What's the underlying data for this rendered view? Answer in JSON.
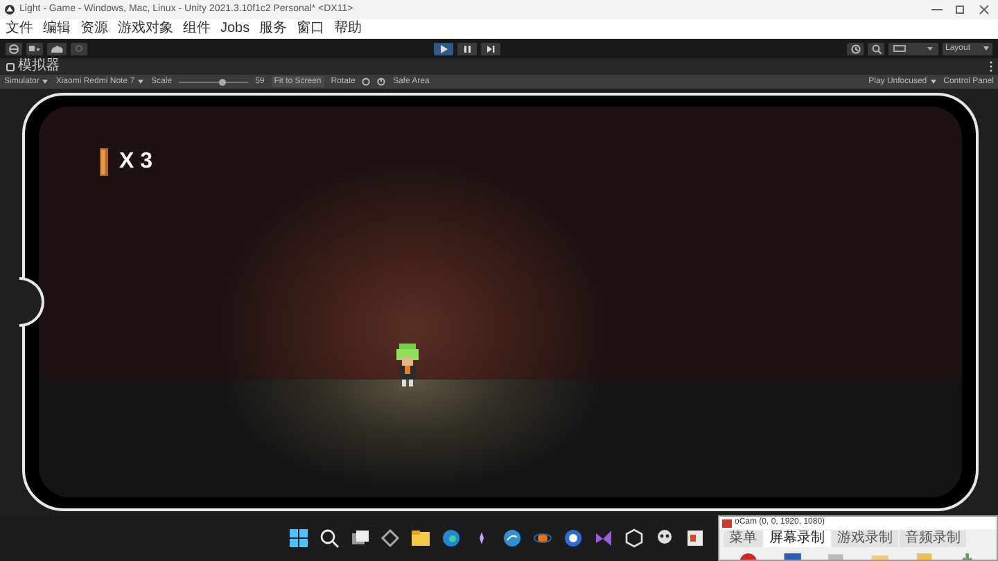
{
  "window": {
    "title": "Light - Game - Windows, Mac, Linux - Unity 2021.3.10f1c2 Personal* <DX11>"
  },
  "menu": [
    "文件",
    "编辑",
    "资源",
    "游戏对象",
    "组件",
    "Jobs",
    "服务",
    "窗口",
    "帮助"
  ],
  "play_controls": [
    {
      "kind": "play",
      "selected": true
    },
    {
      "kind": "pause",
      "selected": false
    },
    {
      "kind": "step",
      "selected": false
    }
  ],
  "layout_dropdown": "Layout",
  "tab": {
    "label": "模拟器"
  },
  "sim_toolbar": {
    "mode": "Simulator",
    "device": "Xiaomi Redmi Note 7",
    "scale_label": "Scale",
    "scale": {
      "level": 0.62
    },
    "scale_value": "59",
    "fit": "Fit to Screen",
    "rotate": "Rotate",
    "safe_area": "Safe Area",
    "play_focus": "Play Unfocused",
    "control_panel": "Control Panel"
  },
  "hud": {
    "count": "X 3"
  },
  "ocam": {
    "title": "oCam (0, 0, 1920, 1080)",
    "tabs": [
      {
        "label": "菜单",
        "selected": false
      },
      {
        "label": "屏幕录制",
        "selected": true
      },
      {
        "label": "游戏录制",
        "selected": false
      },
      {
        "label": "音频录制",
        "selected": false
      }
    ]
  }
}
